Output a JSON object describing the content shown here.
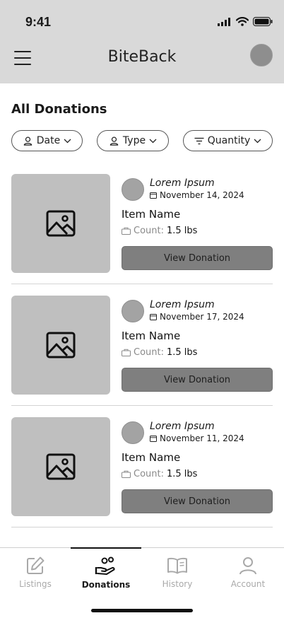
{
  "status_bar": {
    "time": "9:41"
  },
  "header": {
    "title": "BiteBack"
  },
  "page": {
    "section_title": "All Donations"
  },
  "filters": [
    {
      "label": "Date",
      "icon": "user-icon"
    },
    {
      "label": "Type",
      "icon": "user-icon"
    },
    {
      "label": "Quantity",
      "icon": "filter-lines-icon"
    }
  ],
  "donations": [
    {
      "donor": "Lorem Ipsum",
      "date": "November 14, 2024",
      "item_name": "Item Name",
      "count_label": "Count:",
      "count_value": "1.5 lbs",
      "button_label": "View Donation"
    },
    {
      "donor": "Lorem Ipsum",
      "date": "November 17, 2024",
      "item_name": "Item Name",
      "count_label": "Count:",
      "count_value": "1.5 lbs",
      "button_label": "View Donation"
    },
    {
      "donor": "Lorem Ipsum",
      "date": "November 11, 2024",
      "item_name": "Item Name",
      "count_label": "Count:",
      "count_value": "1.5 lbs",
      "button_label": "View Donation"
    }
  ],
  "bottom_nav": [
    {
      "label": "Listings",
      "icon": "edit-icon",
      "active": false
    },
    {
      "label": "Donations",
      "icon": "donate-hand-icon",
      "active": true
    },
    {
      "label": "History",
      "icon": "book-icon",
      "active": false
    },
    {
      "label": "Account",
      "icon": "user-icon",
      "active": false
    }
  ],
  "colors": {
    "header_bg": "#d9d9d9",
    "button_bg": "#7f7f7f",
    "thumb_bg": "#bfbfbf",
    "inactive_nav": "#a9a9a9"
  }
}
